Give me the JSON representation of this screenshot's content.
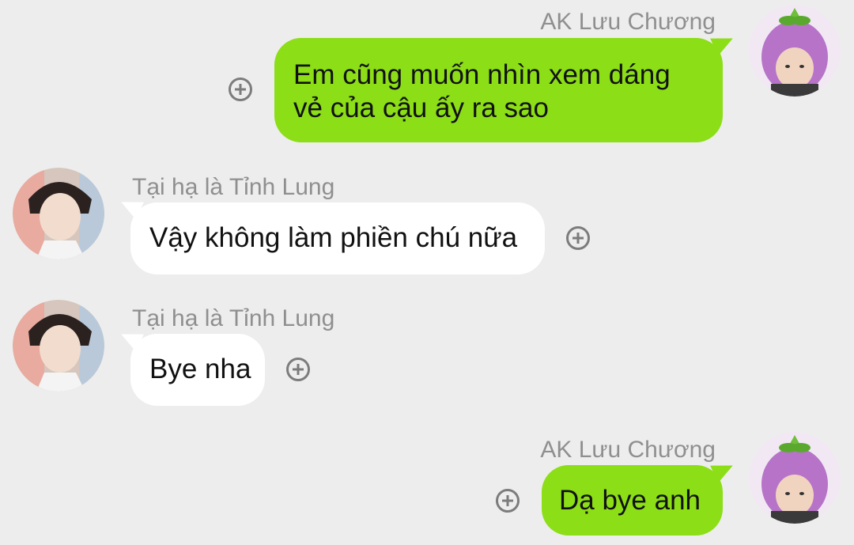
{
  "messages": [
    {
      "sender": "AK Lưu Chương",
      "side": "right",
      "lines": [
        "Em cũng muốn nhìn xem dáng",
        "vẻ của cậu ấy ra sao"
      ],
      "avatar_icon": "eggplant-hat-avatar-icon"
    },
    {
      "sender": "Tại hạ là Tỉnh Lung",
      "side": "left",
      "lines": [
        "Vậy không làm phiền chú nữa"
      ],
      "avatar_icon": "boy-photo-avatar-icon"
    },
    {
      "sender": "Tại hạ là Tỉnh Lung",
      "side": "left",
      "lines": [
        "Bye nha"
      ],
      "avatar_icon": "boy-photo-avatar-icon"
    },
    {
      "sender": "AK Lưu Chương",
      "side": "right",
      "lines": [
        "Dạ bye anh"
      ],
      "avatar_icon": "eggplant-hat-avatar-icon"
    }
  ],
  "colors": {
    "background": "#ededed",
    "outgoing_bubble": "#8cde16",
    "incoming_bubble": "#ffffff",
    "name_text": "#8f8f8f",
    "add_icon": "#7c7c7c"
  },
  "icons": {
    "add": "plus-circle-icon"
  }
}
